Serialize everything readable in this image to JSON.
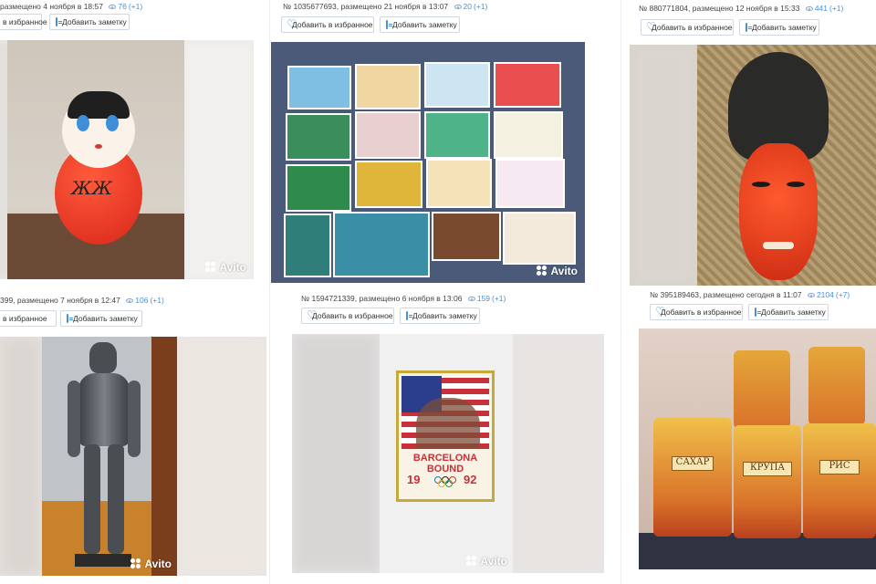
{
  "listings": [
    {
      "meta_text": "размещено 4 ноября в 18:57",
      "views": "76",
      "views_delta": "(+1)",
      "fav_label": "в избранное",
      "note_label": "Добавить заметку",
      "watermark": "Avito",
      "photo_alt": "Неваляшка"
    },
    {
      "meta_text": "№ 1035677693, размещено 21 ноября в 13:07",
      "views": "20",
      "views_delta": "(+1)",
      "fav_label": "Добавить в избранное",
      "note_label": "Добавить заметку",
      "watermark": "Avito",
      "photo_alt": "Открытки"
    },
    {
      "meta_text": "№ 880771804, размещено 12 ноября в 15:33",
      "views": "441",
      "views_delta": "(+1)",
      "fav_label": "Добавить в избранное",
      "note_label": "Добавить заметку",
      "watermark": "Avito",
      "photo_alt": "Маска"
    },
    {
      "meta_text": "399, размещено 7 ноября в 12:47",
      "views": "106",
      "views_delta": "(+1)",
      "fav_label": "в избранное",
      "note_label": "Добавить заметку",
      "watermark": "Avito",
      "photo_alt": "Доспехи"
    },
    {
      "meta_text": "№ 1594721339, размещено 6 ноября в 13:06",
      "views": "159",
      "views_delta": "(+1)",
      "fav_label": "Добавить в избранное",
      "note_label": "Добавить заметку",
      "watermark": "Avito",
      "photo_alt": "Значок Barcelona Bound 1992"
    },
    {
      "meta_text": "№ 395189463, размещено сегодня в 11:07",
      "views": "2104",
      "views_delta": "(+7)",
      "fav_label": "Добавить в избранное",
      "note_label": "Добавить заметку",
      "watermark": "",
      "photo_alt": "Банки"
    }
  ],
  "pin": {
    "line1": "BARCELONA BOUND",
    "year_left": "19",
    "year_right": "92"
  },
  "cans": {
    "labels": [
      "САХАР",
      "КРУПА",
      "РИС"
    ]
  },
  "colors": {
    "accent": "#4a90d9",
    "border": "#cfd8e3"
  }
}
